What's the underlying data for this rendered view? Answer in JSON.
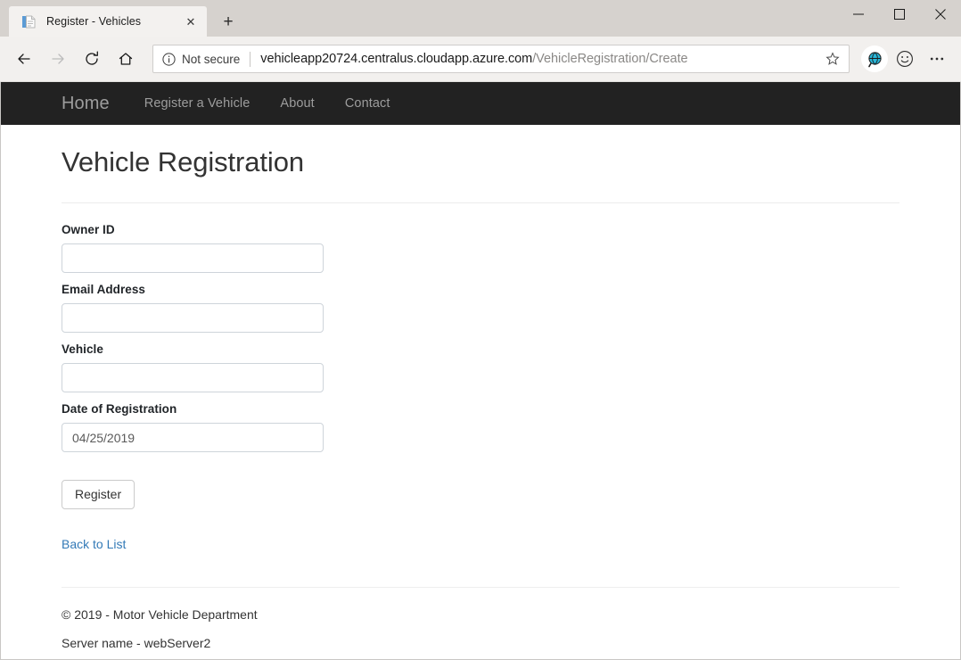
{
  "browser": {
    "tab": {
      "title": "Register - Vehicles",
      "favicon": "document-icon",
      "close_label": "✕"
    },
    "new_tab_label": "+",
    "window_controls": {
      "minimize": "minimize-icon",
      "maximize": "maximize-icon",
      "close": "close-icon"
    },
    "toolbar": {
      "back": "back-arrow-icon",
      "forward": "forward-arrow-icon",
      "refresh": "refresh-icon",
      "home": "home-icon",
      "security_label": "Not secure",
      "url_host": "vehicleapp20724.centralus.cloudapp.azure.com",
      "url_path": "/VehicleRegistration/Create",
      "favorite": "star-icon",
      "collections": "globe-icon",
      "feedback": "smiley-icon",
      "settings": "ellipsis-icon"
    }
  },
  "site": {
    "navbar": {
      "brand": "Home",
      "links": [
        {
          "label": "Register a Vehicle"
        },
        {
          "label": "About"
        },
        {
          "label": "Contact"
        }
      ]
    },
    "page_title": "Vehicle Registration",
    "form": {
      "fields": [
        {
          "label": "Owner ID",
          "value": "",
          "placeholder": ""
        },
        {
          "label": "Email Address",
          "value": "",
          "placeholder": ""
        },
        {
          "label": "Vehicle",
          "value": "",
          "placeholder": ""
        },
        {
          "label": "Date of Registration",
          "value": "04/25/2019",
          "placeholder": ""
        }
      ],
      "submit_label": "Register"
    },
    "back_link": "Back to List",
    "footer": {
      "copyright": "© 2019 - Motor Vehicle Department",
      "server": "Server name - webServer2"
    }
  },
  "colors": {
    "navbar_bg": "#222222",
    "navbar_text": "#9d9d9d",
    "link": "#337ab7",
    "input_border": "#ced4da"
  }
}
